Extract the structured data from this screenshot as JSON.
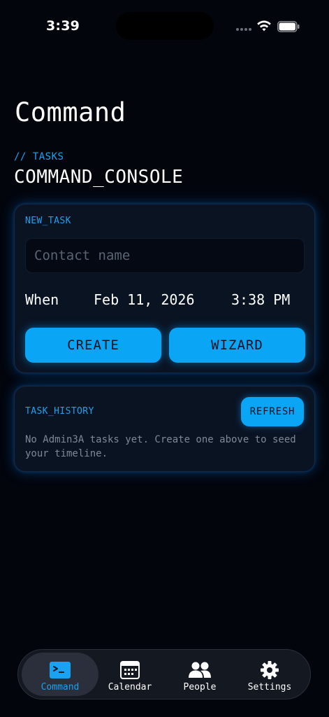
{
  "status_bar": {
    "time": "3:39"
  },
  "header": {
    "title": "Command",
    "kicker": "// TASKS",
    "heading": "COMMAND_CONSOLE"
  },
  "new_task": {
    "label": "NEW_TASK",
    "contact_placeholder": "Contact name",
    "contact_value": "",
    "when_label": "When",
    "date": "Feb 11, 2026",
    "time": "3:38 PM",
    "create_label": "CREATE",
    "wizard_label": "WIZARD"
  },
  "task_history": {
    "label": "TASK_HISTORY",
    "refresh_label": "REFRESH",
    "empty_message": "No Admin3A tasks yet. Create one above to seed your timeline."
  },
  "tab_bar": {
    "active": "Command",
    "items": [
      {
        "label": "Command",
        "icon": "terminal-icon"
      },
      {
        "label": "Calendar",
        "icon": "calendar-icon"
      },
      {
        "label": "People",
        "icon": "people-icon"
      },
      {
        "label": "Settings",
        "icon": "gear-icon"
      }
    ]
  },
  "colors": {
    "accent": "#0aa6f5",
    "accent_text": "#19a2f0",
    "background": "#03050d",
    "card": "#0a1322"
  }
}
